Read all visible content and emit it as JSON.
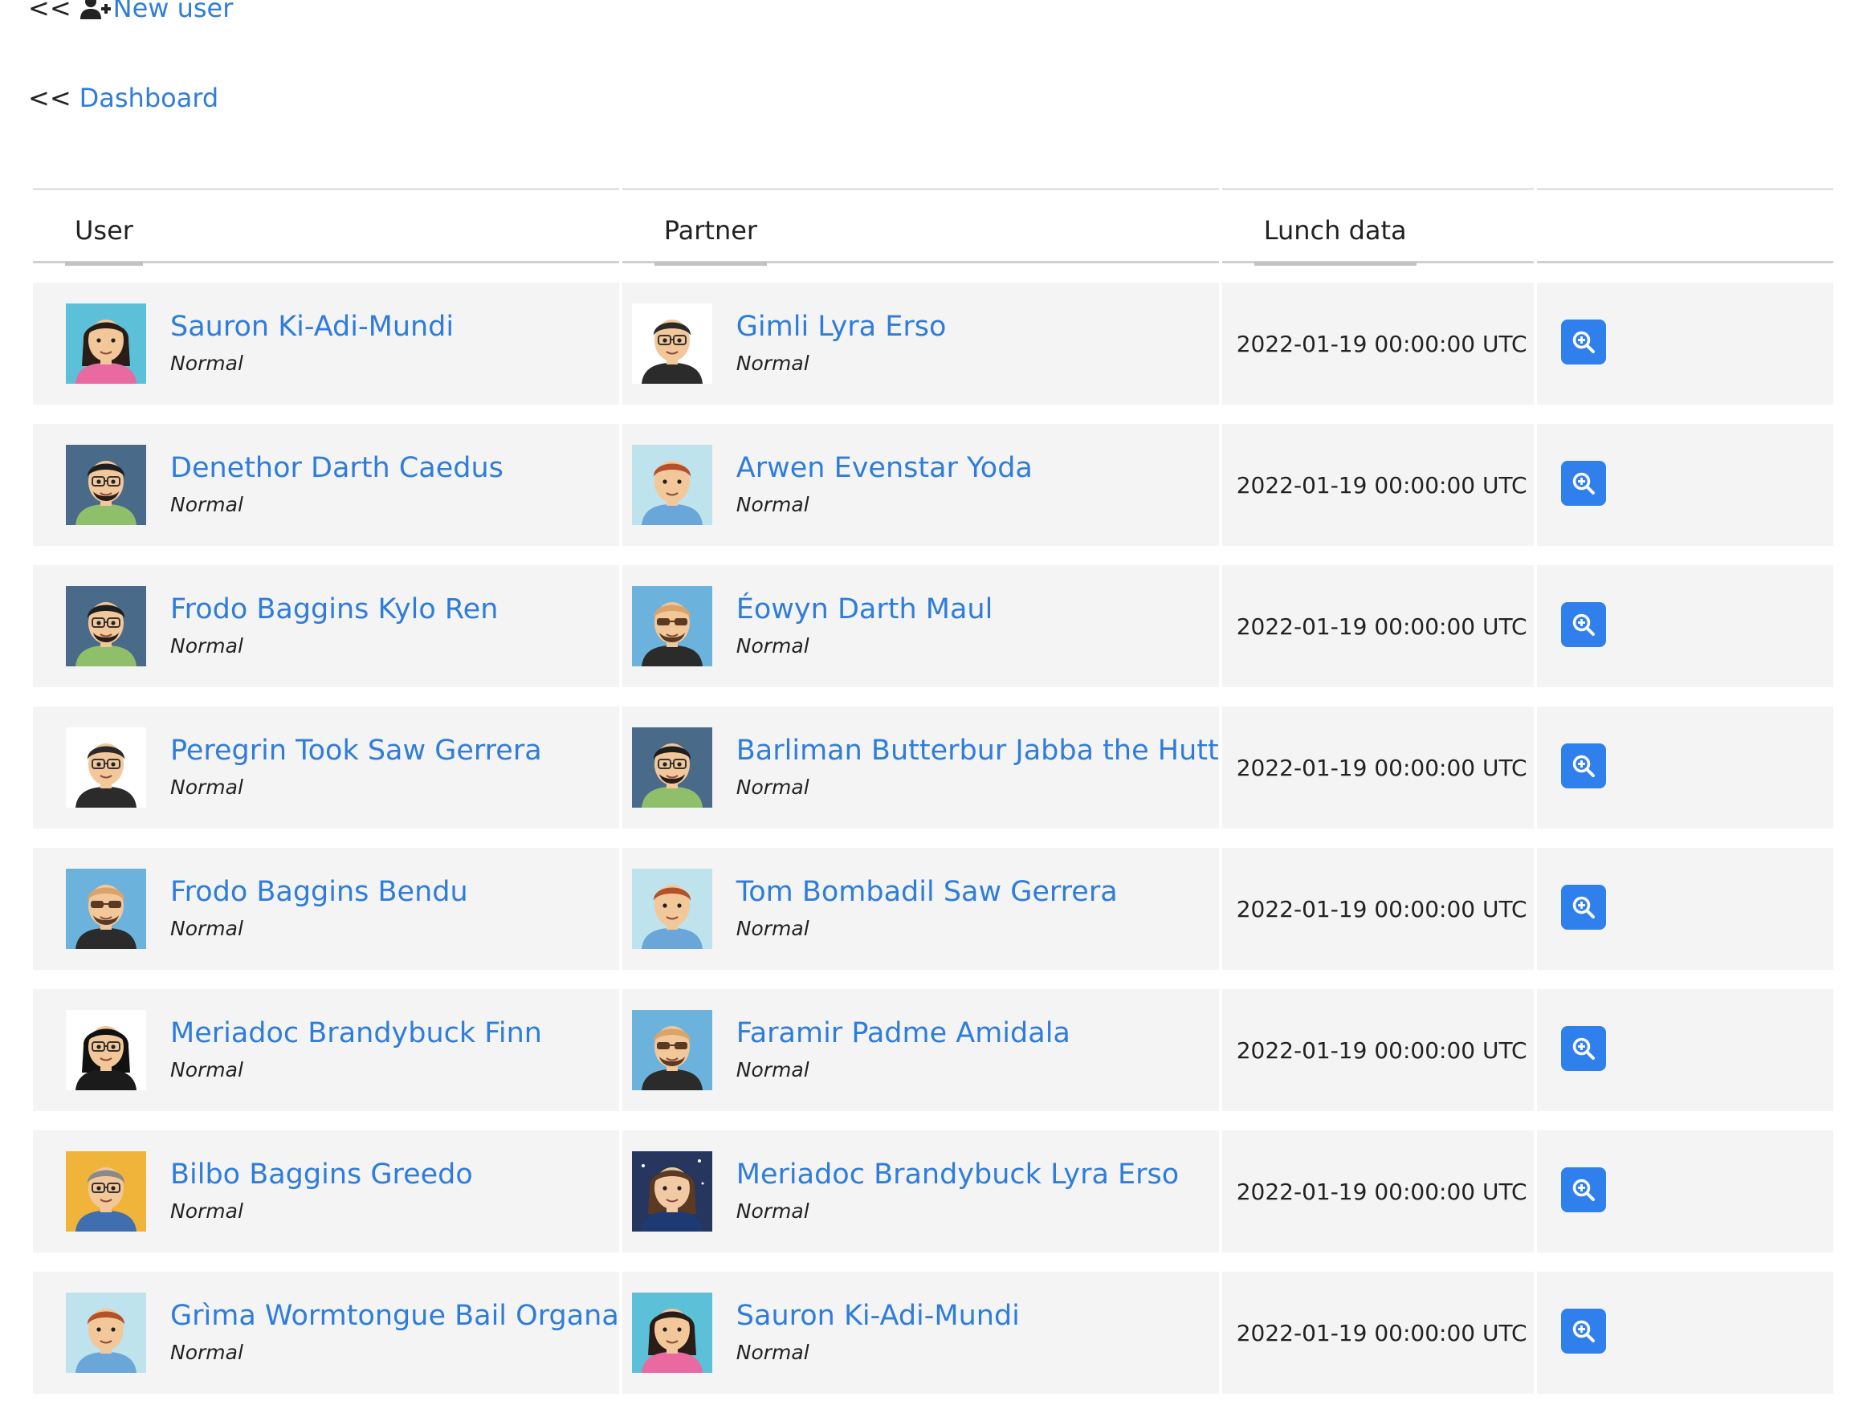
{
  "nav": {
    "new_user": {
      "prefix": "<<",
      "label": "New user",
      "icon": "user-plus-icon"
    },
    "dashboard": {
      "prefix": "<<",
      "label": "Dashboard"
    }
  },
  "table": {
    "headers": [
      "User",
      "Partner",
      "Lunch data",
      ""
    ],
    "rows": [
      {
        "user": {
          "name": "Sauron Ki-Adi-Mundi",
          "role": "Normal",
          "avatar": "female-dark-hair-avatar"
        },
        "partner": {
          "name": "Gimli Lyra Erso",
          "role": "Normal",
          "avatar": "male-glasses-avatar"
        },
        "date": "2022-01-19 00:00:00 UTC",
        "action_icon": "zoom-in-icon"
      },
      {
        "user": {
          "name": "Denethor Darth Caedus",
          "role": "Normal",
          "avatar": "male-beard-glasses-avatar"
        },
        "partner": {
          "name": "Arwen Evenstar Yoda",
          "role": "Normal",
          "avatar": "male-ginger-avatar"
        },
        "date": "2022-01-19 00:00:00 UTC",
        "action_icon": "zoom-in-icon"
      },
      {
        "user": {
          "name": "Frodo Baggins Kylo Ren",
          "role": "Normal",
          "avatar": "male-beard-glasses-avatar"
        },
        "partner": {
          "name": "Éowyn Darth Maul",
          "role": "Normal",
          "avatar": "male-sunglasses-goatee-avatar"
        },
        "date": "2022-01-19 00:00:00 UTC",
        "action_icon": "zoom-in-icon"
      },
      {
        "user": {
          "name": "Peregrin Took Saw Gerrera",
          "role": "Normal",
          "avatar": "male-glasses-avatar"
        },
        "partner": {
          "name": "Barliman Butterbur Jabba the Hutt",
          "role": "Normal",
          "avatar": "male-beard-glasses-avatar"
        },
        "date": "2022-01-19 00:00:00 UTC",
        "action_icon": "zoom-in-icon"
      },
      {
        "user": {
          "name": "Frodo Baggins Bendu",
          "role": "Normal",
          "avatar": "male-sunglasses-goatee-avatar"
        },
        "partner": {
          "name": "Tom Bombadil Saw Gerrera",
          "role": "Normal",
          "avatar": "male-ginger-avatar"
        },
        "date": "2022-01-19 00:00:00 UTC",
        "action_icon": "zoom-in-icon"
      },
      {
        "user": {
          "name": "Meriadoc Brandybuck Finn",
          "role": "Normal",
          "avatar": "male-long-hair-glasses-avatar"
        },
        "partner": {
          "name": "Faramir Padme Amidala",
          "role": "Normal",
          "avatar": "male-sunglasses-goatee-avatar"
        },
        "date": "2022-01-19 00:00:00 UTC",
        "action_icon": "zoom-in-icon"
      },
      {
        "user": {
          "name": "Bilbo Baggins Greedo",
          "role": "Normal",
          "avatar": "male-grey-glasses-avatar"
        },
        "partner": {
          "name": "Meriadoc Brandybuck Lyra Erso",
          "role": "Normal",
          "avatar": "female-night-sky-avatar"
        },
        "date": "2022-01-19 00:00:00 UTC",
        "action_icon": "zoom-in-icon"
      },
      {
        "user": {
          "name": "Grìma Wormtongue Bail Organa",
          "role": "Normal",
          "avatar": "male-ginger-avatar"
        },
        "partner": {
          "name": "Sauron Ki-Adi-Mundi",
          "role": "Normal",
          "avatar": "female-dark-hair-avatar"
        },
        "date": "2022-01-19 00:00:00 UTC",
        "action_icon": "zoom-in-icon"
      }
    ]
  },
  "colors": {
    "link": "#2f7ddb",
    "button": "#2f80ed",
    "row_bg": "#f4f4f4"
  }
}
